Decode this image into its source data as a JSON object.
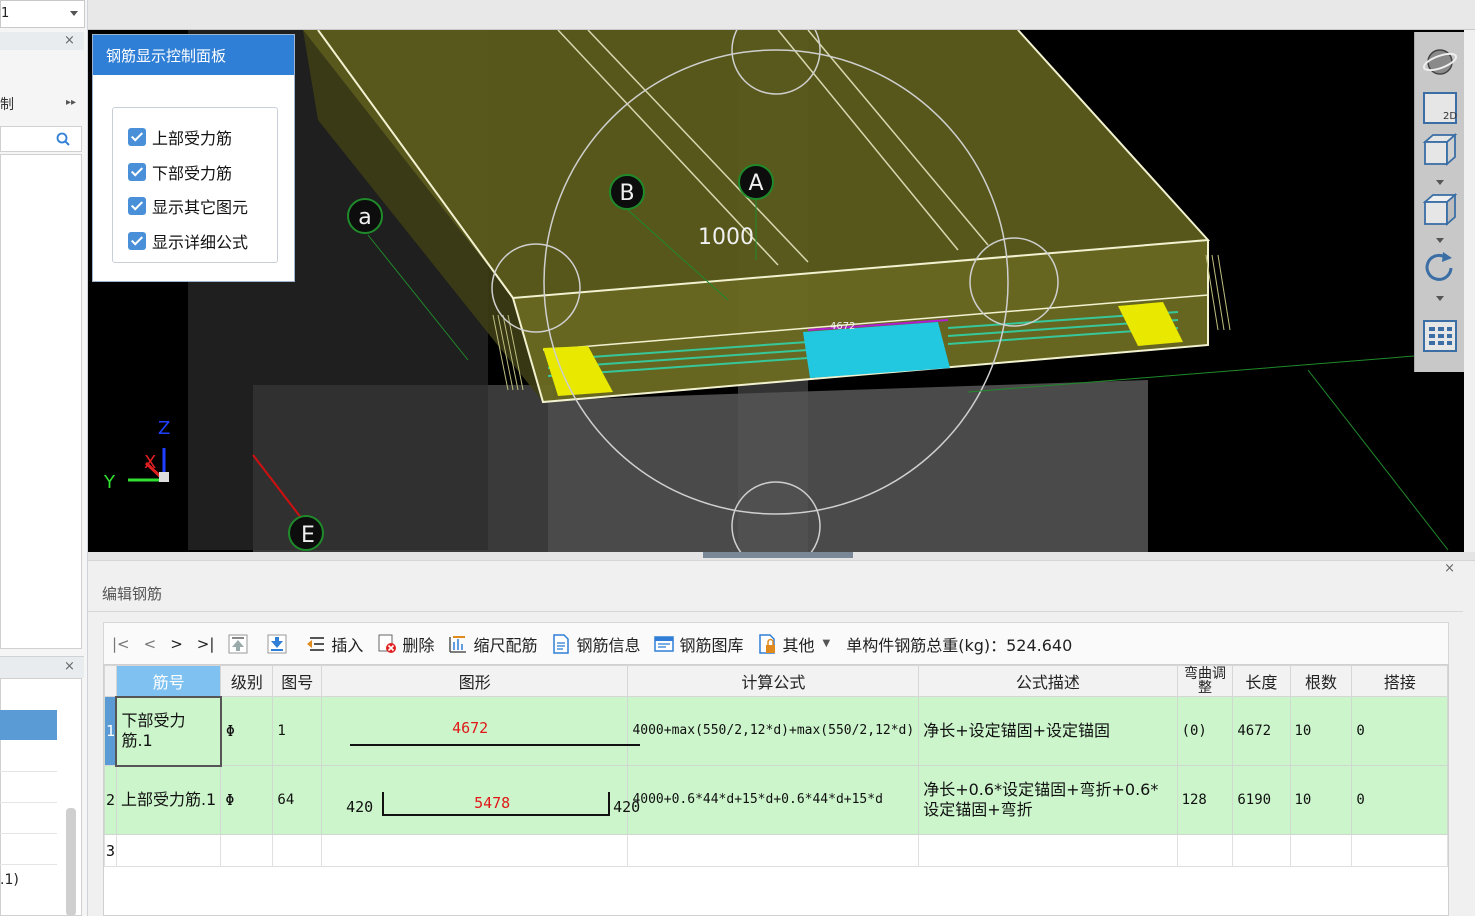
{
  "left_panel": {
    "combo_value": "1",
    "close_glyph": "×",
    "control_label": "制",
    "expand_glyph": "▸▸",
    "close2_glyph": "×",
    "bottom_value": ".1)"
  },
  "control_panel": {
    "title": "钢筋显示控制面板",
    "options": [
      {
        "label": "上部受力筋",
        "checked": true
      },
      {
        "label": "下部受力筋",
        "checked": true
      },
      {
        "label": "显示其它图元",
        "checked": true
      },
      {
        "label": "显示详细公式",
        "checked": true
      }
    ]
  },
  "viewport": {
    "axis_labels": [
      "a",
      "B",
      "A",
      "E"
    ],
    "dimension": "1000",
    "small_label": "4672",
    "gizmo": {
      "z": "Z",
      "x": "X",
      "y": "Y"
    },
    "colors": {
      "slab": "#8f8f2e",
      "rebar_yellow": "#e8e800",
      "rebar_green": "#36c79a",
      "rebar_cyan": "#22c8e0"
    }
  },
  "right_toolbar": {
    "icons": [
      "orbit-icon",
      "2d-view-icon",
      "box-view-icon",
      "box-solid-icon",
      "rotate-icon",
      "grid-view-icon"
    ],
    "label_2d": "2D"
  },
  "edit_panel": {
    "title": "编辑钢筋",
    "close_glyph": "×",
    "toolbar": {
      "nav": [
        "|<",
        "<",
        ">",
        ">|"
      ],
      "insert": "插入",
      "delete": "删除",
      "scale": "缩尺配筋",
      "info": "钢筋信息",
      "library": "钢筋图库",
      "other": "其他",
      "total": "单构件钢筋总重(kg)：524.640"
    },
    "columns": [
      "筋号",
      "级别",
      "图号",
      "图形",
      "计算公式",
      "公式描述",
      "弯曲调整",
      "长度",
      "根数",
      "搭接"
    ],
    "rows": [
      {
        "num": "1",
        "name": "下部受力筋.1",
        "grade": "Φ",
        "fig": "1",
        "shape_len": "4672",
        "side_left": "",
        "side_right": "",
        "formula": "4000+max(550/2,12*d)+max(550/2,12*d)",
        "desc": "净长+设定锚固+设定锚固",
        "bend": "(0)",
        "length": "4672",
        "count": "10",
        "lap": "0"
      },
      {
        "num": "2",
        "name": "上部受力筋.1",
        "grade": "Φ",
        "fig": "64",
        "shape_len": "5478",
        "side_left": "420",
        "side_right": "420",
        "formula": "4000+0.6*44*d+15*d+0.6*44*d+15*d",
        "desc": "净长+0.6*设定锚固+弯折+0.6*设定锚固+弯折",
        "bend": "128",
        "length": "6190",
        "count": "10",
        "lap": "0"
      },
      {
        "num": "3"
      }
    ]
  }
}
